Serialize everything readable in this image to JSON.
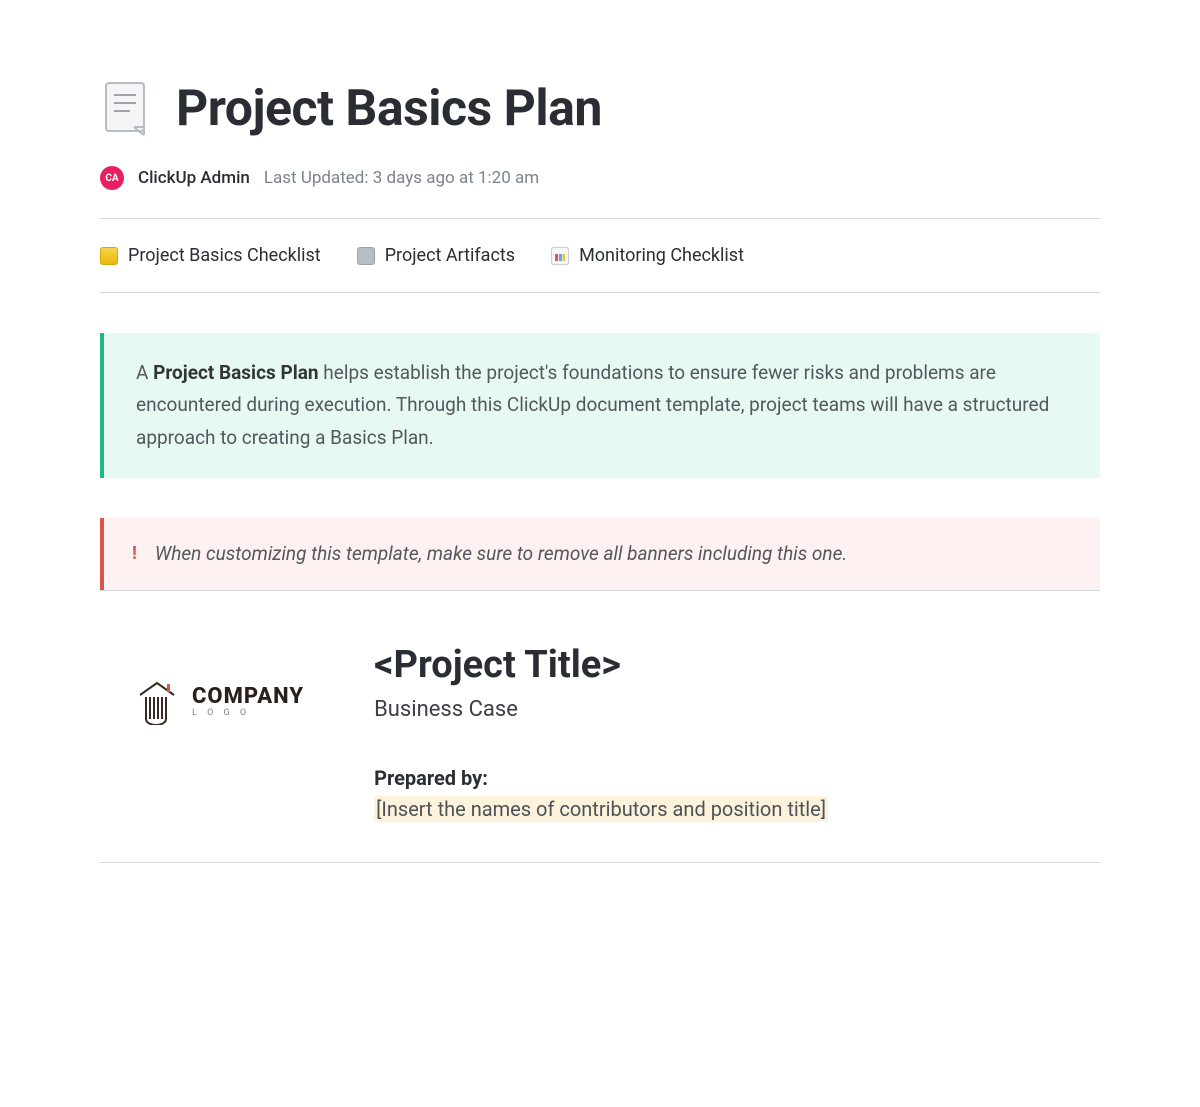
{
  "header": {
    "title": "Project Basics Plan",
    "author": "ClickUp Admin",
    "avatar_initials": "CA",
    "last_updated": "Last Updated: 3 days ago at 1:20 am"
  },
  "tabs": [
    {
      "label": "Project Basics Checklist"
    },
    {
      "label": "Project Artifacts"
    },
    {
      "label": "Monitoring Checklist"
    }
  ],
  "callouts": {
    "intro_prefix": "A ",
    "intro_strong": "Project Basics Plan",
    "intro_rest": " helps establish the project's foundations to ensure fewer risks and problems are encountered during execution. Through this ClickUp document template, project teams will have a structured approach to creating a Basics Plan.",
    "warning_icon": "!",
    "warning": "When customizing this template, make sure to remove all banners including this one."
  },
  "company": {
    "logo_text": "COMPANY",
    "logo_sub": "L O G O"
  },
  "project": {
    "title": "<Project Title>",
    "subtitle": "Business Case",
    "prepared_label": "Prepared by:",
    "prepared_hint": "[Insert the names of contributors and position title]"
  }
}
